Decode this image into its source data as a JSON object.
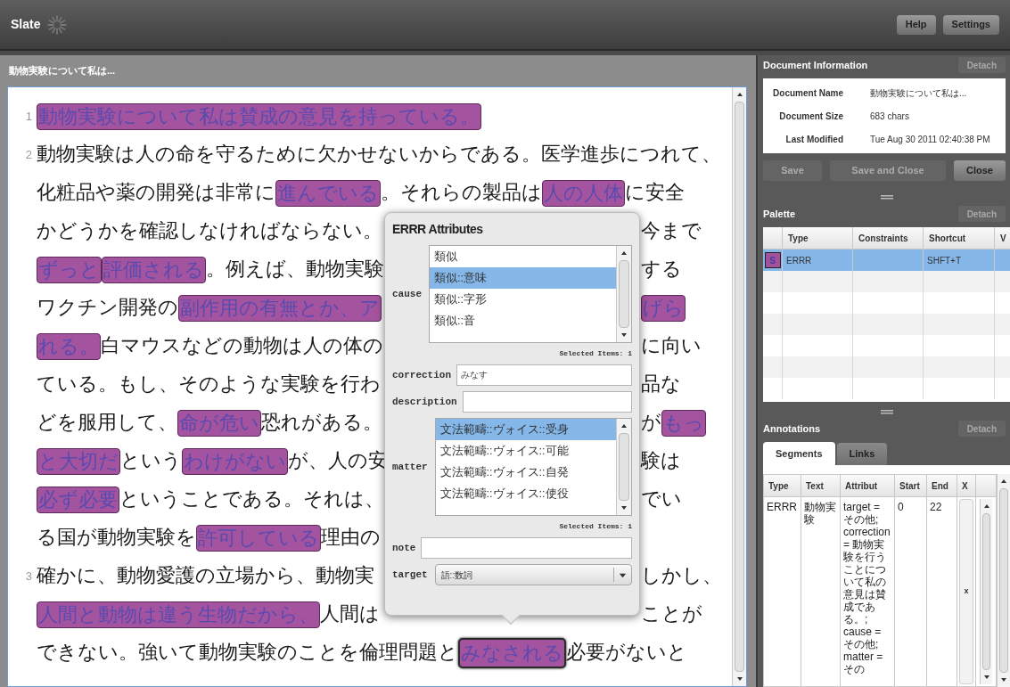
{
  "app": {
    "title": "Slate",
    "buttons": [
      "Help",
      "Settings"
    ]
  },
  "document": {
    "title": "動物実験について私は...",
    "lines": [
      {
        "number": "1",
        "left": [
          {
            "kind": "annotation",
            "text": "動物実験について私は賛成の意見を持っている。",
            "selected": false
          }
        ]
      },
      {
        "number": "2",
        "left": [
          {
            "kind": "plain",
            "text": "動物実験は人の命を守るために欠かせないからである。医学進歩につれて、"
          }
        ]
      },
      {
        "left": [
          {
            "kind": "plain",
            "text": "化粧品や薬の開発は非常に"
          },
          {
            "kind": "annotation",
            "text": "進んでいる",
            "selected": false
          },
          {
            "kind": "plain",
            "text": "。それらの製品は"
          },
          {
            "kind": "annotation",
            "text": "人の人体",
            "selected": false
          },
          {
            "kind": "plain",
            "text": "に安全"
          }
        ]
      },
      {
        "left": [
          {
            "kind": "plain",
            "text": "かどうかを確認しなければならない。"
          }
        ],
        "right": [
          {
            "kind": "plain",
            "text": "今まで"
          }
        ]
      },
      {
        "left": [
          {
            "kind": "annotation",
            "text": "ずっと",
            "selected": false
          },
          {
            "kind": "annotation",
            "text": "評価される",
            "selected": false
          },
          {
            "kind": "plain",
            "text": "。例えば、動物実験"
          }
        ],
        "right": [
          {
            "kind": "plain",
            "text": "する"
          }
        ]
      },
      {
        "left": [
          {
            "kind": "plain",
            "text": "ワクチン開発の"
          },
          {
            "kind": "annotation",
            "text": "副作用の有無とか、ア",
            "selected": false
          }
        ],
        "right": [
          {
            "kind": "annotation",
            "text": "げら",
            "selected": false
          }
        ]
      },
      {
        "left": [
          {
            "kind": "annotation",
            "text": "れる。",
            "selected": false
          },
          {
            "kind": "plain",
            "text": "白マウスなどの動物は人の体の"
          }
        ],
        "right": [
          {
            "kind": "plain",
            "text": "に向い"
          }
        ]
      },
      {
        "left": [
          {
            "kind": "plain",
            "text": "ている。もし、そのような実験を行わ"
          }
        ],
        "right": [
          {
            "kind": "plain",
            "text": "品な"
          }
        ]
      },
      {
        "left": [
          {
            "kind": "plain",
            "text": "どを服用して、"
          },
          {
            "kind": "annotation",
            "text": "命が危い",
            "selected": false
          },
          {
            "kind": "plain",
            "text": "恐れがある。"
          }
        ],
        "right": [
          {
            "kind": "plain",
            "text": "が"
          },
          {
            "kind": "annotation",
            "text": "もっ",
            "selected": false
          }
        ]
      },
      {
        "left": [
          {
            "kind": "annotation",
            "text": "と大切だ",
            "selected": false
          },
          {
            "kind": "plain",
            "text": "という"
          },
          {
            "kind": "annotation",
            "text": "わけがない",
            "selected": false
          },
          {
            "kind": "plain",
            "text": "が、人の安"
          }
        ],
        "right": [
          {
            "kind": "plain",
            "text": "験は"
          }
        ]
      },
      {
        "left": [
          {
            "kind": "annotation",
            "text": "必ず必要",
            "selected": false
          },
          {
            "kind": "plain",
            "text": "ということである。それは、"
          }
        ],
        "right": [
          {
            "kind": "plain",
            "text": "でい"
          }
        ]
      },
      {
        "left": [
          {
            "kind": "plain",
            "text": "る国が動物実験を"
          },
          {
            "kind": "annotation",
            "text": "許可している",
            "selected": false
          },
          {
            "kind": "plain",
            "text": "理由の"
          }
        ]
      },
      {
        "number": "3",
        "left": [
          {
            "kind": "plain",
            "text": "確かに、動物愛護の立場から、動物実"
          }
        ],
        "right": [
          {
            "kind": "plain",
            "text": "しかし、"
          }
        ]
      },
      {
        "left": [
          {
            "kind": "annotation",
            "text": "人間と動物は違う生物だから、",
            "selected": false
          },
          {
            "kind": "plain",
            "text": "人間は"
          }
        ],
        "right": [
          {
            "kind": "plain",
            "text": "ことが"
          }
        ]
      },
      {
        "left": [
          {
            "kind": "plain",
            "text": "できない。強いて動物実験のことを倫理問題と"
          },
          {
            "kind": "annotation",
            "text": "みなされる",
            "selected": true
          },
          {
            "kind": "plain",
            "text": "必要がないと"
          }
        ]
      }
    ]
  },
  "popup": {
    "title": "ERRR Attributes",
    "fields": [
      {
        "kind": "list",
        "label": "cause",
        "options": [
          {
            "text": "類似",
            "selected": false
          },
          {
            "text": "類似::意味",
            "selected": true
          },
          {
            "text": "類似::字形",
            "selected": false
          },
          {
            "text": "類似::音",
            "selected": false
          }
        ],
        "footer": "Selected Items: 1"
      },
      {
        "kind": "text",
        "label": "correction",
        "value": "みなす"
      },
      {
        "kind": "text",
        "label": "description"
      },
      {
        "kind": "list",
        "label": "matter",
        "options": [
          {
            "text": "文法範疇::ヴォイス::受身",
            "selected": true
          },
          {
            "text": "文法範疇::ヴォイス::可能",
            "selected": false
          },
          {
            "text": "文法範疇::ヴォイス::自発",
            "selected": false
          },
          {
            "text": "文法範疇::ヴォイス::使役",
            "selected": false
          }
        ],
        "footer": "Selected Items: 1"
      },
      {
        "kind": "text",
        "label": "note"
      },
      {
        "kind": "select",
        "label": "target",
        "value": "語::数詞"
      }
    ]
  },
  "document_information": {
    "title": "Document Information",
    "detach": {
      "label": "Detach",
      "disabled": true
    },
    "fields": [
      {
        "label": "Document Name",
        "value": "動物実験について私は..."
      },
      {
        "label": "Document Size",
        "value": "683 chars"
      },
      {
        "label": "Last Modified",
        "value": "Tue Aug 30 2011 02:40:38 PM"
      }
    ],
    "buttons": [
      {
        "label": "Save",
        "disabled": true
      },
      {
        "label": "Save and Close",
        "disabled": true
      },
      {
        "label": "Close",
        "disabled": false
      }
    ]
  },
  "palette": {
    "title": "Palette",
    "detach": {
      "label": "Detach",
      "disabled": true
    },
    "columns": [
      "Type",
      "Constraints",
      "Shortcut",
      "V"
    ],
    "rows": [
      {
        "swatch": "S",
        "color": "#a2529c",
        "type": "ERRR",
        "shortcut": "SHFT+T",
        "selected": true
      }
    ]
  },
  "annotations": {
    "title": "Annotations",
    "detach": {
      "label": "Detach",
      "disabled": true
    },
    "tabs": [
      {
        "label": "Segments",
        "selected": true
      },
      {
        "label": "Links",
        "selected": false
      }
    ],
    "columns": [
      "Type",
      "Text",
      "Attribut",
      "Start",
      "End",
      "X"
    ],
    "rows": [
      {
        "type": "ERRR",
        "text": "動物実験",
        "attributes": "target = その他; correction = 動物実験を行うことについて私の意見は賛成である。; cause = その他; matter = その",
        "start": "0",
        "end": "22",
        "delete": "x"
      }
    ]
  }
}
